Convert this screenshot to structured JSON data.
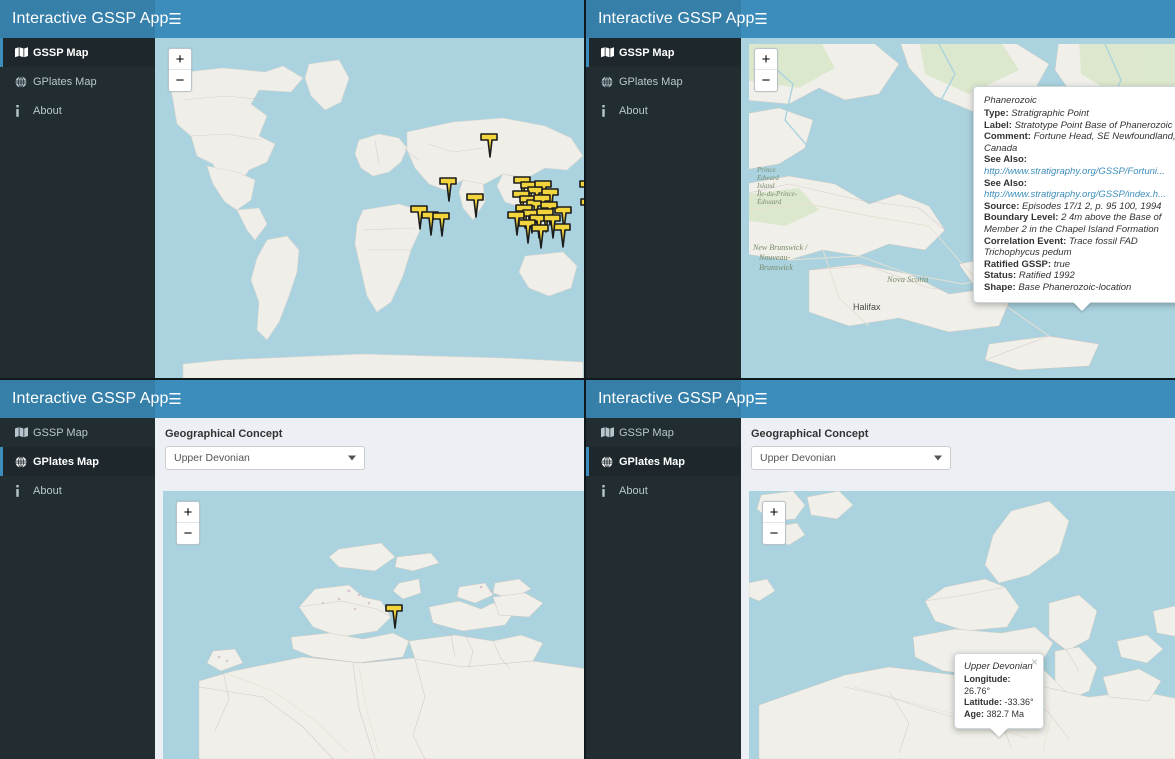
{
  "app": {
    "title": "Interactive GSSP App",
    "menu_icon": "hamburger-icon"
  },
  "sidebar": {
    "items": [
      {
        "label": "GSSP Map",
        "icon": "map-icon"
      },
      {
        "label": "GPlates Map",
        "icon": "globe-icon"
      },
      {
        "label": "About",
        "icon": "info-icon"
      }
    ]
  },
  "panels": {
    "top_left": {
      "active_item": "GSSP Map",
      "map_type": "world-gssp-map"
    },
    "top_right": {
      "active_item": "GSSP Map",
      "map_type": "detail-street-map"
    },
    "bottom_left": {
      "active_item": "GPlates Map",
      "map_type": "paleogeographic-map"
    },
    "bottom_right": {
      "active_item": "GPlates Map",
      "map_type": "paleogeographic-map"
    }
  },
  "form": {
    "label": "Geographical Concept",
    "selected": "Upper Devonian",
    "options": [
      "Upper Devonian"
    ]
  },
  "zoom_controls": {
    "zoom_in": "+",
    "zoom_out": "−"
  },
  "gssp_popup": {
    "close": "×",
    "title": "Phanerozoic",
    "rows": [
      {
        "key": "Type:",
        "value": "Stratigraphic Point"
      },
      {
        "key": "Label:",
        "value": "Stratotype Point Base of Phanerozoic"
      },
      {
        "key": "Comment:",
        "value": "Fortune Head, SE Newfoundland, Canada"
      },
      {
        "key": "See Also:",
        "value": "http://www.stratigraphy.org/GSSP/Fortuni...",
        "link": true
      },
      {
        "key": "See Also:",
        "value": "http://www.stratigraphy.org/GSSP/index.h...",
        "link": true
      },
      {
        "key": "Source:",
        "value": "Episodes 17/1 2, p. 95 100, 1994"
      },
      {
        "key": "Boundary Level:",
        "value": "2 4m above the Base of Member 2 in the Chapel Island Formation"
      },
      {
        "key": "Correlation Event:",
        "value": "Trace fossil FAD Trichophycus pedum"
      },
      {
        "key": "Ratified GSSP:",
        "value": "true"
      },
      {
        "key": "Status:",
        "value": "Ratified 1992"
      },
      {
        "key": "Shape:",
        "value": "Base Phanerozoic-location"
      }
    ]
  },
  "gplates_popup": {
    "close": "×",
    "title": "Upper Devonian",
    "rows": [
      {
        "key": "Longitude:",
        "value": "26.76°"
      },
      {
        "key": "Latitude:",
        "value": "-33.36°"
      },
      {
        "key": "Age:",
        "value": "382.7 Ma"
      }
    ]
  },
  "map_labels": {
    "detail": [
      "New Brunswick /",
      "Nouveau-",
      "Brunswick",
      "Nova Scotia",
      "Halifax"
    ]
  },
  "colors": {
    "navbar": "#3c8dbc",
    "logo": "#367fa9",
    "sidebar": "#222d32",
    "sidebar_active": "#1e282c",
    "content_bg": "#ecf0f5",
    "water": "#aad3df",
    "land": "#efeee9",
    "marker": "#f2d43c",
    "link": "#3c8dbc"
  }
}
